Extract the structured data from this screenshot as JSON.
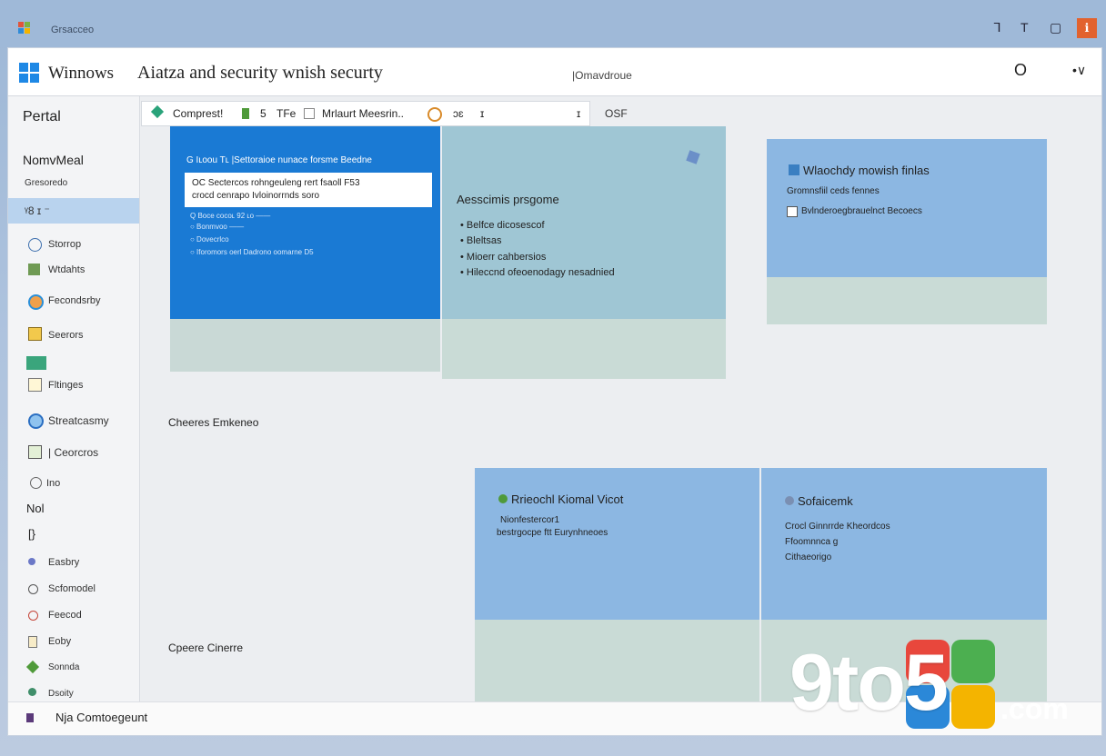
{
  "outer": {
    "title": "Grsacceo",
    "controls": [
      "ᒣ",
      "T",
      "▢",
      "ℹ"
    ]
  },
  "header": {
    "app_name": "Winnows",
    "page_title": "Aiatza and security wnish securty",
    "center_label": "|Omavdroue",
    "right_icons": [
      "O",
      "•∨"
    ]
  },
  "sidebar": {
    "heading": "Pertal",
    "section": "NomvMeal",
    "sub": "Gresoredo",
    "selected": "ᵞ8 ɪ ⁻",
    "items": [
      {
        "label": "Storrop",
        "icon": "clock-icon"
      },
      {
        "label": "Wtdahts",
        "icon": "widget-icon"
      },
      {
        "label": "Fecondsrby",
        "icon": "shield-icon"
      },
      {
        "label": "Seerors",
        "icon": "folder-icon"
      },
      {
        "label": "",
        "icon": "image-icon"
      },
      {
        "label": "Fltinges",
        "icon": "document-icon"
      },
      {
        "label": "Streatcasmy",
        "icon": "globe-icon"
      },
      {
        "label": "| Ceorcros",
        "icon": "monitor-icon"
      },
      {
        "label": "Ino",
        "icon": "gear-icon"
      }
    ],
    "section2": "Nol",
    "section2_icon": "[}",
    "items2": [
      {
        "label": "Easbry",
        "icon": "pin-icon"
      },
      {
        "label": "Scfomodel",
        "icon": "clock-icon"
      },
      {
        "label": "Feecod",
        "icon": "feed-icon"
      },
      {
        "label": "Eoby",
        "icon": "document-icon"
      },
      {
        "label": "Sonnda",
        "icon": "leaf-icon"
      },
      {
        "label": "Dsoity",
        "icon": "person-icon"
      }
    ]
  },
  "toolbar": {
    "items": [
      "Comprest!",
      "5",
      "TFe",
      "Mrlaurt Meesrin..",
      "ɔɛ",
      "ɪ",
      "ɪ"
    ],
    "trailing": "OSF"
  },
  "card_blue": {
    "header": "G  Iʟoou Tʟ |Settoraioe nunace forsme Beedne",
    "input_line1": "OC  Sectercos rohngeuleng rert fsaoll F53",
    "input_line2": "crocd cenrapo Ivloinorrnds soro",
    "list": [
      "Q  Boce cocoʟ 92 ʟo ——",
      "○  Bonmvoo  ——",
      "○  Dovecrlco",
      "○  Iforomors oerl Dadrono oomarne D5"
    ]
  },
  "card_teal": {
    "title": "Aesscimis prsgome",
    "bullets": [
      "Belfce dicosescof",
      "Bleltsas",
      "Mioerr cahbersios",
      "Hileccnd ofeoenodagy nesadnied"
    ]
  },
  "card_right": {
    "title": "Wlaochdy mowish finlas",
    "subtitle": "Gromnsfiil ceds fennes",
    "line": "Bvlnderoegbrauelnct Becoecs"
  },
  "section_labels": {
    "one": "Cheeres Emkeneo",
    "two": "Cpeere Cinerre"
  },
  "card_bottom_left": {
    "title": "Rrieochl Kiomal Vicot",
    "line1": "Nionfestercor1",
    "line2": "bestrgocpe ftt Eurynhneoes"
  },
  "card_bottom_right": {
    "title": "Sofaicemk",
    "lines": [
      "Crocl Ginnrrde Kheordcos",
      "Ffoomnnca g",
      "Cithaeorigo"
    ]
  },
  "bottom_bar": {
    "label": "Nja Comtoegeunt"
  },
  "watermark": {
    "text": "9to5",
    "domain": ".com"
  }
}
